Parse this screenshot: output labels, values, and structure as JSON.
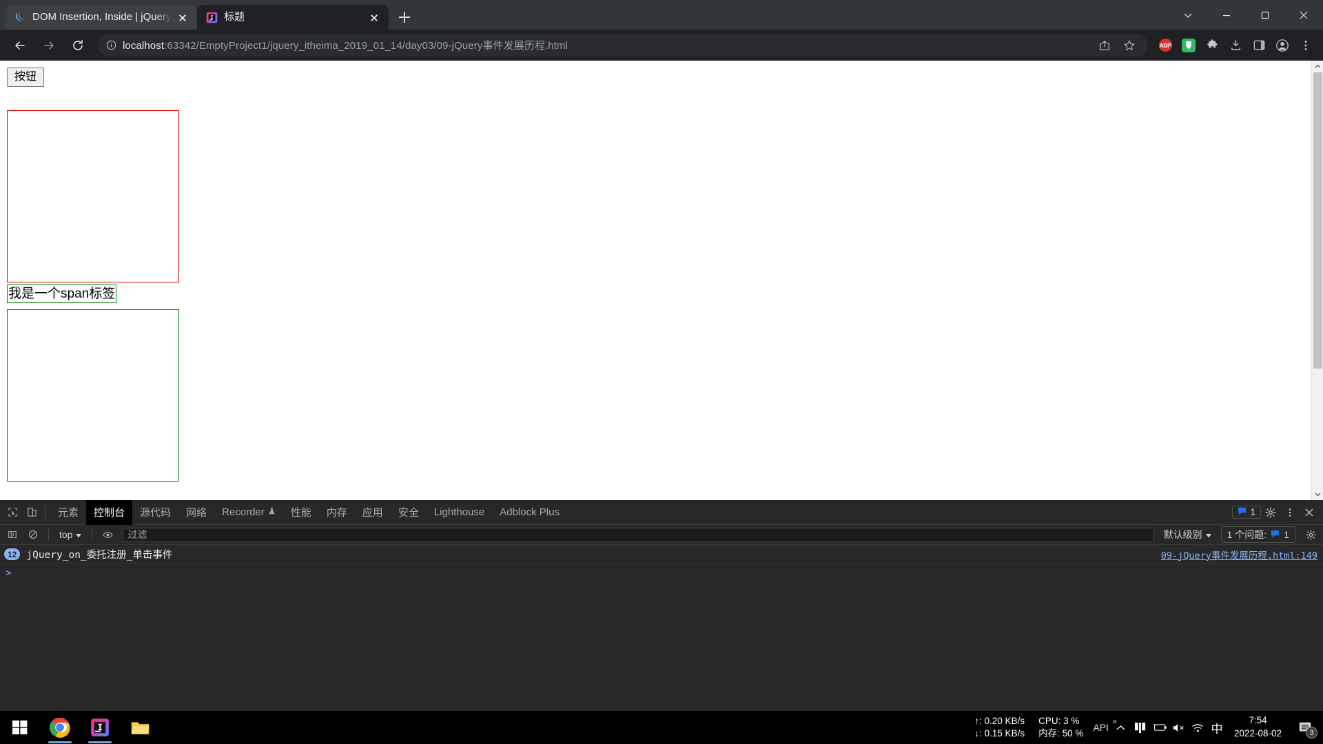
{
  "browser": {
    "tabs": [
      {
        "title": "DOM Insertion, Inside | jQuery",
        "favicon": "jquery-icon",
        "active": false
      },
      {
        "title": "标题",
        "favicon": "jetbrains-icon",
        "active": true
      }
    ],
    "new_tab_label": "+",
    "window_controls": [
      "minimize",
      "maximize",
      "close"
    ],
    "nav": {
      "back": "返回",
      "forward": "前进",
      "reload": "重新加载"
    },
    "omnibox": {
      "info_icon": "info-circle-icon",
      "url_host": "localhost",
      "url_rest": ":63342/EmptyProject1/jquery_itheima_2019_01_14/day03/09-jQuery事件发展历程.html",
      "full_url": "localhost:63342/EmptyProject1/jquery_itheima_2019_01_14/day03/09-jQuery事件发展历程.html",
      "actions": [
        "share-icon",
        "bookmark-star-icon"
      ]
    },
    "extensions": [
      {
        "name": "adblock-plus-icon",
        "label": "ABP"
      },
      {
        "name": "evernote-icon",
        "label": ""
      },
      {
        "name": "extensions-puzzle-icon",
        "label": ""
      },
      {
        "name": "downloads-icon",
        "label": ""
      },
      {
        "name": "side-panel-icon",
        "label": ""
      },
      {
        "name": "profile-avatar-icon",
        "label": ""
      },
      {
        "name": "chrome-menu-icon",
        "label": ""
      }
    ]
  },
  "page": {
    "button_label": "按钮",
    "span_label": "我是一个span标签",
    "box_red_color": "#e00000",
    "box_green_color": "#008000"
  },
  "devtools": {
    "tabs": [
      {
        "label": "元素",
        "selected": false
      },
      {
        "label": "控制台",
        "selected": true
      },
      {
        "label": "源代码",
        "selected": false
      },
      {
        "label": "网络",
        "selected": false
      },
      {
        "label": "Recorder",
        "selected": false,
        "badge": "flask-icon"
      },
      {
        "label": "性能",
        "selected": false
      },
      {
        "label": "内存",
        "selected": false
      },
      {
        "label": "应用",
        "selected": false
      },
      {
        "label": "安全",
        "selected": false
      },
      {
        "label": "Lighthouse",
        "selected": false
      },
      {
        "label": "Adblock Plus",
        "selected": false
      }
    ],
    "left_icons": [
      "inspect-element-icon",
      "device-toolbar-icon"
    ],
    "right": {
      "issues_count": "1",
      "settings_icon": "gear-icon",
      "more_icon": "kebab-menu-icon",
      "close_icon": "close-icon"
    },
    "console_toolbar": {
      "sidebar_icon": "console-sidebar-icon",
      "clear_icon": "clear-console-icon",
      "context": "top",
      "eye_icon": "live-expression-eye-icon",
      "filter_placeholder": "过滤",
      "filter_value": "",
      "level": "默认级别",
      "issues_label": "1 个问题:",
      "issues_value": "1",
      "settings_icon": "gear-icon"
    },
    "console_messages": [
      {
        "count": "12",
        "text": "jQuery_on_委托注册_单击事件",
        "source": "09-jQuery事件发展历程.html:149"
      }
    ],
    "prompt_caret": ">"
  },
  "taskbar": {
    "start": "windows-start-icon",
    "apps": [
      {
        "name": "chrome-taskbar-icon",
        "open": true
      },
      {
        "name": "jetbrains-taskbar-icon",
        "open": true
      },
      {
        "name": "file-explorer-taskbar-icon",
        "open": false
      }
    ],
    "net_up": "↑: 0.20 KB/s",
    "net_down": "↓: 0.15 KB/s",
    "cpu": "CPU: 3 %",
    "mem": "内存: 50 %",
    "api_label": "API",
    "tray_icons": [
      "chevron-up-icon",
      "app-tray-icon",
      "battery-icon",
      "volume-muted-icon",
      "wifi-icon"
    ],
    "ime": "中",
    "time": "7:54",
    "date": "2022-08-02",
    "notification_count": "3"
  }
}
